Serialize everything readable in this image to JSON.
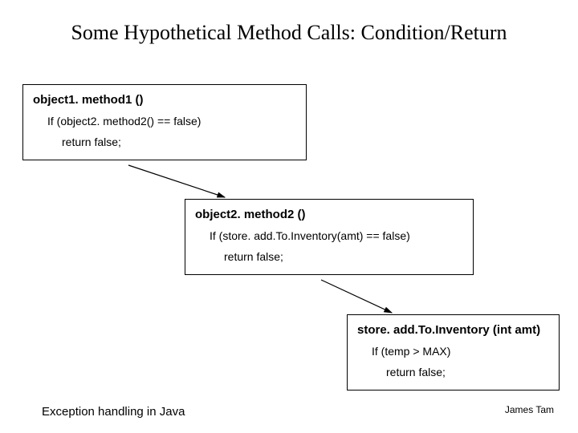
{
  "title": "Some Hypothetical Method Calls: Condition/Return",
  "box1": {
    "header": "object1. method1 ()",
    "cond": "If (object2. method2() == false)",
    "ret": "return false;"
  },
  "box2": {
    "header": "object2. method2 ()",
    "cond": "If (store. add.To.Inventory(amt) == false)",
    "ret": "return false;"
  },
  "box3": {
    "header": "store. add.To.Inventory (int amt)",
    "cond": "If (temp > MAX)",
    "ret": "return false;"
  },
  "footer": {
    "left": "Exception handling in Java",
    "right": "James Tam"
  }
}
